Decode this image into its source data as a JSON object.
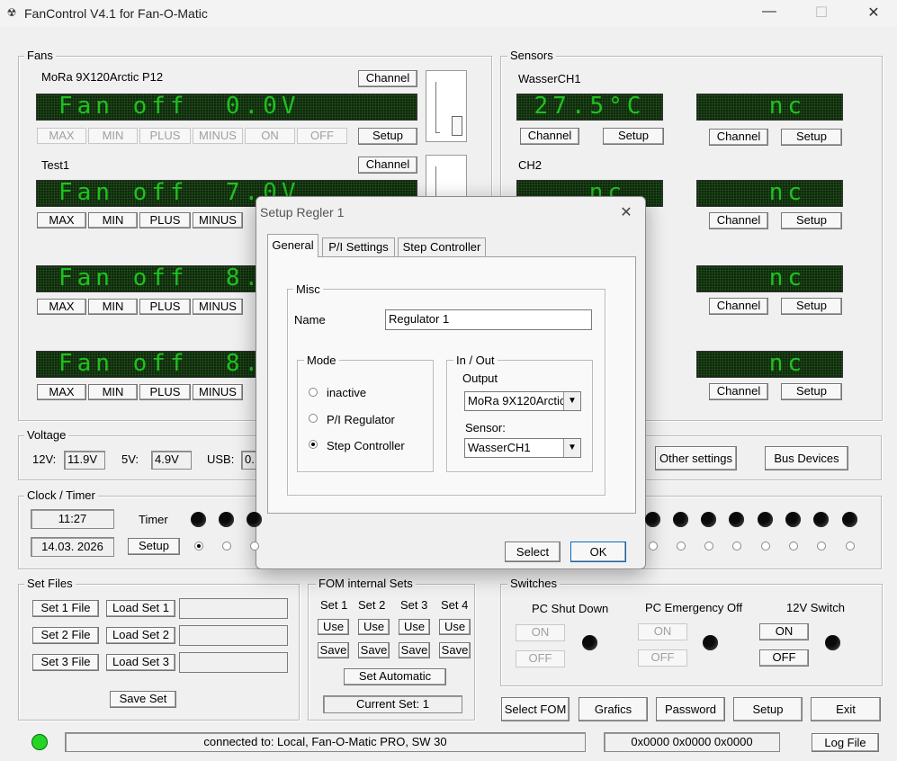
{
  "window": {
    "title": "FanControl V4.1 for Fan-O-Matic",
    "min": "—",
    "max": "☐",
    "close": "✕"
  },
  "fans": {
    "label": "Fans",
    "fan1": {
      "name": "MoRa 9X120Arctic P12",
      "lcd": "Fan off  0.0V"
    },
    "fan2": {
      "name": "Test1",
      "lcd": "Fan off  7.0V"
    },
    "fan3": {
      "lcd": "Fan off  8."
    },
    "fan4": {
      "lcd": "Fan off  8."
    },
    "buttons": {
      "max": "MAX",
      "min": "MIN",
      "plus": "PLUS",
      "minus": "MINUS",
      "on": "ON",
      "off": "OFF",
      "setup": "Setup",
      "channel": "Channel"
    }
  },
  "sensors": {
    "label": "Sensors",
    "s1": {
      "name": "WasserCH1",
      "lcd": "27.5°C"
    },
    "s2": {
      "name": "CH2",
      "lcd": "nc"
    },
    "nc": "nc",
    "channel": "Channel",
    "setup": "Setup"
  },
  "voltage": {
    "label": "Voltage",
    "v12_label": "12V:",
    "v12": "11.9V",
    "v5_label": "5V:",
    "v5": "4.9V",
    "usb_label": "USB:",
    "usb": "0."
  },
  "buttons_right": {
    "other": "Other settings",
    "bus": "Bus Devices"
  },
  "clock": {
    "label": "Clock / Timer",
    "time": "11:27",
    "date": "14.03. 2026",
    "timer": "Timer",
    "setup": "Setup"
  },
  "setfiles": {
    "label": "Set Files",
    "set1": "Set 1 File",
    "set2": "Set 2 File",
    "set3": "Set 3 File",
    "load1": "Load Set 1",
    "load2": "Load Set 2",
    "load3": "Load Set 3",
    "save": "Save Set"
  },
  "fom": {
    "label": "FOM internal Sets",
    "sets": [
      "Set 1",
      "Set 2",
      "Set 3",
      "Set 4"
    ],
    "use": "Use",
    "save": "Save",
    "auto": "Set Automatic",
    "current": "Current Set: 1"
  },
  "switches": {
    "label": "Switches",
    "shutdown": "PC Shut Down",
    "emergency": "PC Emergency Off",
    "v12": "12V Switch",
    "on": "ON",
    "off": "OFF"
  },
  "bottom": {
    "selectfom": "Select FOM",
    "grafics": "Grafics",
    "password": "Password",
    "setup": "Setup",
    "exit": "Exit",
    "logfile": "Log File"
  },
  "status": {
    "connection": "connected to: Local, Fan-O-Matic PRO, SW 30",
    "codes": "0x0000 0x0000 0x0000"
  },
  "dialog": {
    "title": "Setup Regler 1",
    "tabs": [
      "General",
      "P/I Settings",
      "Step Controller"
    ],
    "misc": "Misc",
    "name_label": "Name",
    "name_value": "Regulator 1",
    "mode": "Mode",
    "modes": [
      "inactive",
      "P/I Regulator",
      "Step Controller"
    ],
    "inout": "In / Out",
    "output_label": "Output",
    "output_value": "MoRa 9X120Arctic",
    "sensor_label": "Sensor:",
    "sensor_value": "WasserCH1",
    "select": "Select",
    "ok": "OK",
    "close": "✕"
  }
}
